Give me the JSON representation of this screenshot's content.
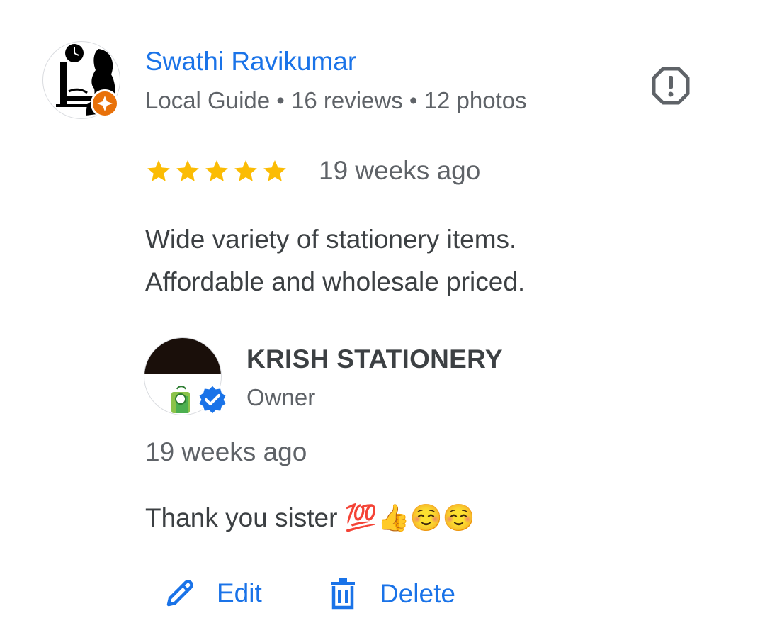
{
  "reviewer": {
    "name": "Swathi Ravikumar",
    "meta": "Local Guide • 16 reviews • 12 photos",
    "avatar_icon": "reviewer-avatar",
    "badge_icon": "local-guide-badge-icon",
    "badge_color": "#e8710a"
  },
  "review": {
    "rating": 5,
    "rating_max": 5,
    "star_color": "#fbbc04",
    "date": "19 weeks ago",
    "text_lines": [
      "Wide variety of stationery items.",
      "Affordable and wholesale priced."
    ]
  },
  "owner_reply": {
    "name": "KRISH STATIONERY",
    "role": "Owner",
    "date": "19 weeks ago",
    "text": "Thank you sister 💯👍☺️☺️",
    "verified_icon": "verified-badge-icon",
    "verified_color": "#1a73e8"
  },
  "actions": {
    "edit_label": "Edit",
    "delete_label": "Delete",
    "accent": "#1a73e8"
  },
  "icons": {
    "report": "report-icon",
    "edit": "pencil-icon",
    "delete": "trash-icon",
    "star": "star-icon"
  }
}
